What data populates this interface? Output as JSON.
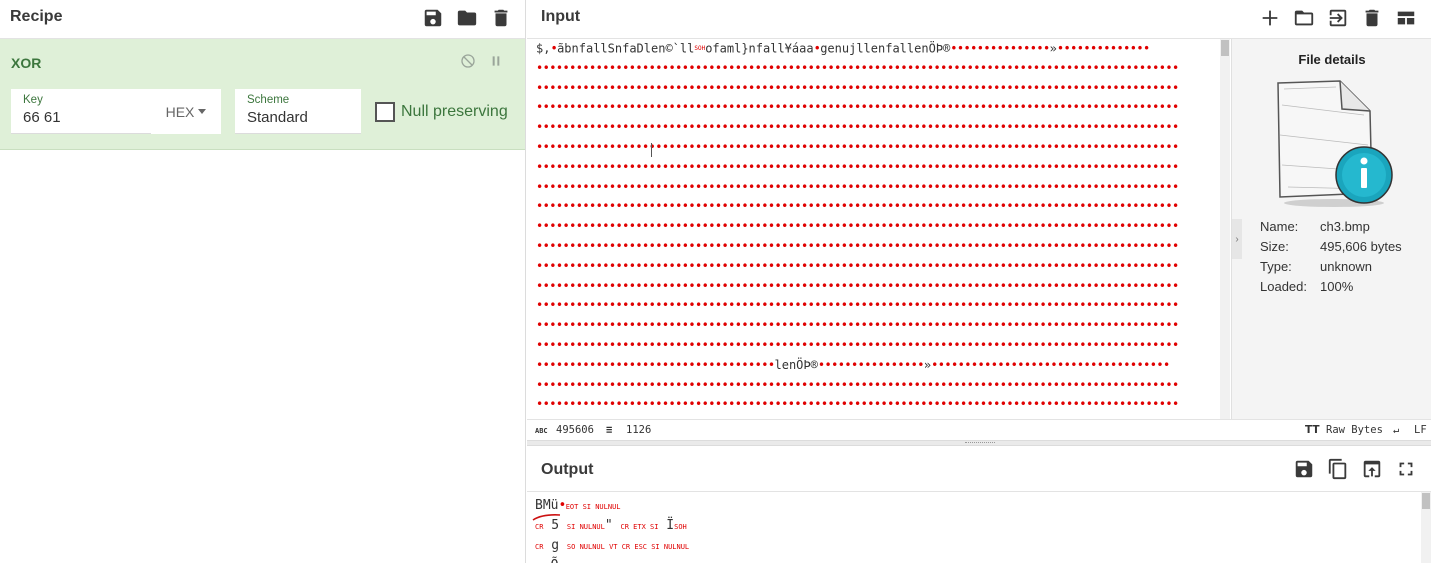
{
  "recipe": {
    "title": "Recipe",
    "icons": [
      "save-icon",
      "folder-icon",
      "trash-icon"
    ],
    "operation": {
      "name": "XOR",
      "key_label": "Key",
      "key_value": "66 61",
      "key_format": "HEX",
      "scheme_label": "Scheme",
      "scheme_value": "Standard",
      "null_preserving_label": "Null preserving",
      "null_preserving_checked": false
    }
  },
  "input": {
    "title": "Input",
    "icons": [
      "plus-icon",
      "folder-icon",
      "import-icon",
      "trash-icon",
      "layout-icon"
    ],
    "first_line_prefix": "$,",
    "first_line_text_a": "ãbnfallSnfaDlen©`ll",
    "first_line_ctl": "SOH",
    "first_line_text_b": "ofaml}nfall¥áaa",
    "first_line_text_c": "genujllenfallenÖÞ®",
    "line_19_text": "lenÖÞ®",
    "status": {
      "length": "495606",
      "lines": "1126",
      "encoding": "Raw Bytes",
      "eol": "LF"
    },
    "file_details": {
      "title": "File details",
      "name_label": "Name:",
      "name": "ch3.bmp",
      "size_label": "Size:",
      "size": "495,606 bytes",
      "type_label": "Type:",
      "type": "unknown",
      "loaded_label": "Loaded:",
      "loaded": "100%"
    }
  },
  "output": {
    "title": "Output",
    "icons": [
      "save-icon",
      "copy-icon",
      "replace-input-icon",
      "fullscreen-icon"
    ],
    "line1_text": "BMü",
    "line1_ctl": "EOT SI NULNUL",
    "line2_ctl_a": "CR",
    "line2_text": "5",
    "line2_ctl_b": "SI NULNUL",
    "line2_text_b": "\"",
    "line2_ctl_c": "CR ETX SI",
    "line2_text_c": "Ï",
    "line2_ctl_d": "SOH",
    "line3_ctl_a": "CR",
    "line3_text": "g",
    "line3_ctl_b": "SO NULNUL VT CR ESC SI NULNUL",
    "line4_text": "Õ"
  }
}
